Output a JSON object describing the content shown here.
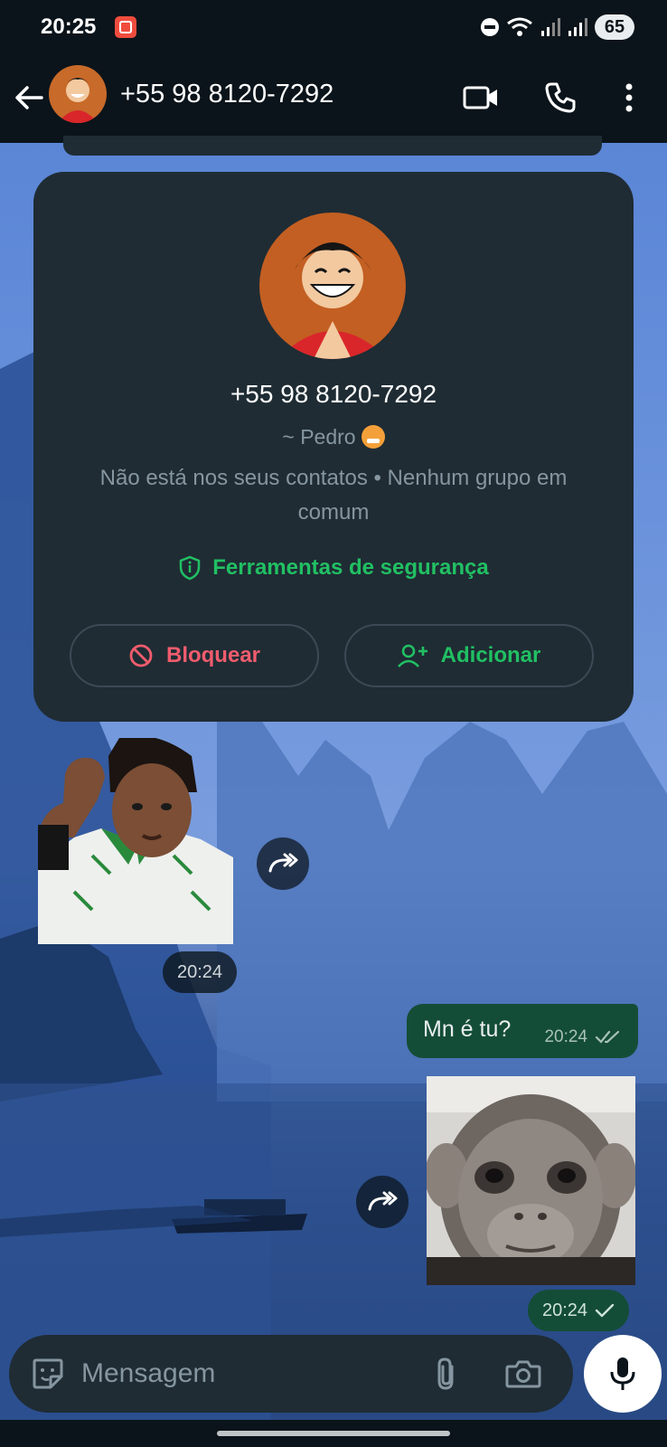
{
  "status_bar": {
    "time": "20:25",
    "battery": "65"
  },
  "header": {
    "title": "+55 98 8120-7292",
    "icons": [
      "back-arrow-icon",
      "video-call-icon",
      "voice-call-icon",
      "more-options-icon"
    ]
  },
  "contact_card": {
    "phone": "+55 98 8120-7292",
    "name": "~ Pedro",
    "info": "Não está nos seus contatos • Nenhum grupo em comum",
    "safety_label": "Ferramentas de segurança",
    "block_label": "Bloquear",
    "add_label": "Adicionar"
  },
  "messages": [
    {
      "type": "sticker",
      "direction": "incoming",
      "time": "20:24"
    },
    {
      "type": "text",
      "direction": "outgoing",
      "text": "Mn é tu?",
      "time": "20:24",
      "status": "delivered"
    },
    {
      "type": "sticker",
      "direction": "outgoing",
      "time": "20:24",
      "status": "sent"
    }
  ],
  "composer": {
    "placeholder": "Mensagem"
  },
  "colors": {
    "accent": "#21c063",
    "danger": "#f15c6d",
    "outgoing_bubble": "#144d37",
    "card_bg": "#1f2c34"
  }
}
